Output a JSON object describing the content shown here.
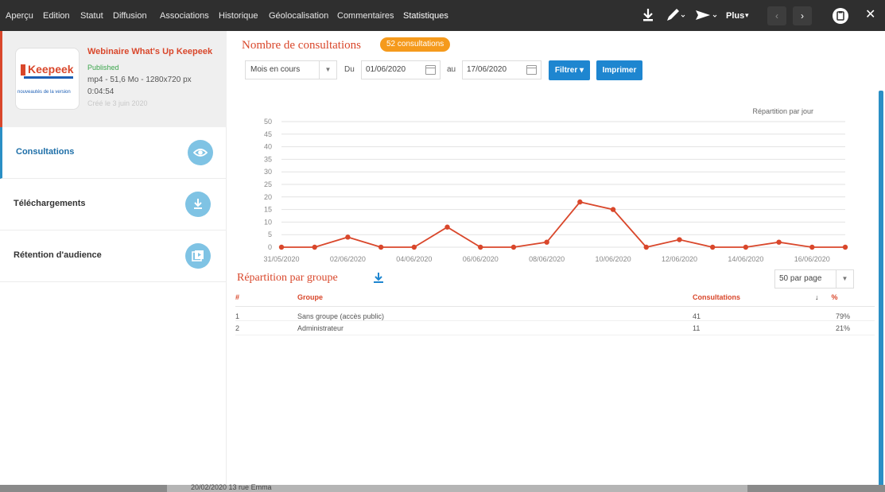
{
  "nav": {
    "tabs": [
      "Aperçu",
      "Edition",
      "Statut",
      "Diffusion",
      "Associations",
      "Historique",
      "Géolocalisation",
      "Commentaires",
      "Statistiques"
    ],
    "active_tab": "Statistiques",
    "plus_label": "Plus",
    "icons": [
      "download-icon",
      "pencil-icon",
      "send-icon",
      "chevron-left-icon",
      "chevron-right-icon",
      "clipboard-icon",
      "close-icon"
    ]
  },
  "asset": {
    "title": "Webinaire What's Up Keepeek",
    "status": "Published",
    "meta": "mp4 - 51,6 Mo - 1280x720 px",
    "duration": "0:04:54",
    "created": "Créé le 3 juin 2020",
    "thumb_logo": "Keepeek",
    "thumb_caption": "nouveautés de la version"
  },
  "sidebar": {
    "items": [
      {
        "label": "Consultations",
        "icon": "eye-icon",
        "active": true
      },
      {
        "label": "Téléchargements",
        "icon": "download-icon",
        "active": false
      },
      {
        "label": "Rétention d'audience",
        "icon": "play-icon",
        "active": false
      }
    ]
  },
  "stats": {
    "title": "Nombre de consultations",
    "badge": "52 consultations",
    "period_select": "Mois en cours",
    "from_label": "Du",
    "from_date": "01/06/2020",
    "to_label": "au",
    "to_date": "17/06/2020",
    "filter_label": "Filtrer",
    "print_label": "Imprimer"
  },
  "chart_data": {
    "type": "line",
    "title": "Répartition par jour",
    "x": [
      "31/05/2020",
      "01/06/2020",
      "02/06/2020",
      "03/06/2020",
      "04/06/2020",
      "05/06/2020",
      "06/06/2020",
      "07/06/2020",
      "08/06/2020",
      "09/06/2020",
      "10/06/2020",
      "11/06/2020",
      "12/06/2020",
      "13/06/2020",
      "14/06/2020",
      "15/06/2020",
      "16/06/2020",
      "17/06/2020"
    ],
    "x_tick_labels": [
      "31/05/2020",
      "02/06/2020",
      "04/06/2020",
      "06/06/2020",
      "08/06/2020",
      "10/06/2020",
      "12/06/2020",
      "14/06/2020",
      "16/06/2020"
    ],
    "values": [
      0,
      0,
      4,
      0,
      0,
      8,
      0,
      0,
      2,
      18,
      15,
      0,
      3,
      0,
      0,
      2,
      0,
      0
    ],
    "yticks": [
      0,
      5,
      10,
      15,
      20,
      25,
      30,
      35,
      40,
      45,
      50
    ],
    "ylim": [
      0,
      50
    ],
    "grid": true,
    "color": "#d9472b"
  },
  "groups": {
    "title": "Répartition par groupe",
    "per_page": "50 par page",
    "columns": [
      "#",
      "Groupe",
      "Consultations",
      "%"
    ],
    "rows": [
      {
        "idx": "1",
        "name": "Sans groupe (accès public)",
        "count": "41",
        "pct": "79%"
      },
      {
        "idx": "2",
        "name": "Administrateur",
        "count": "11",
        "pct": "21%"
      }
    ]
  },
  "background": {
    "text": "20/02/2020 13 rue Emma"
  }
}
